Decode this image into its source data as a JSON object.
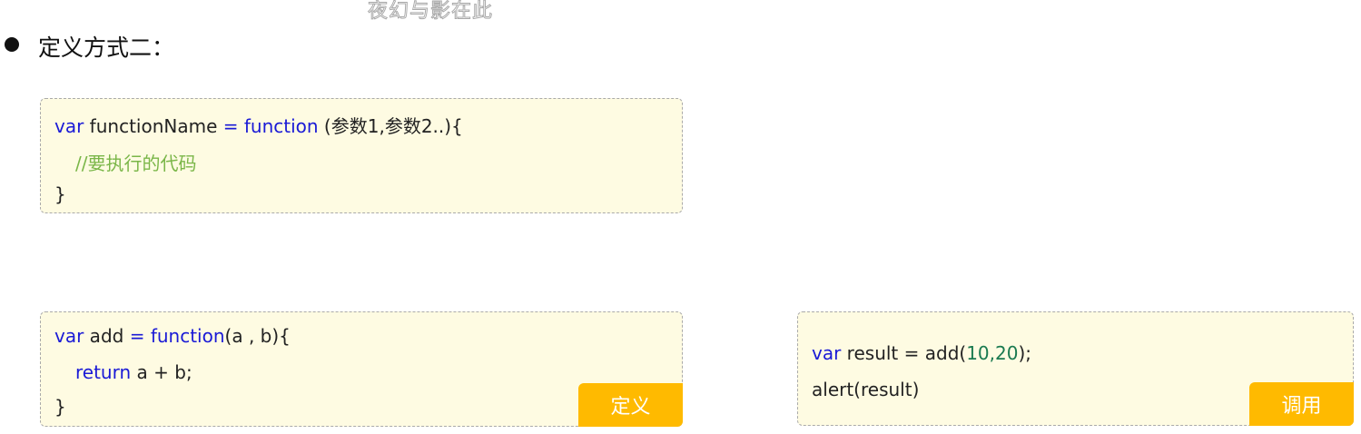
{
  "watermark": "夜幻与影在此",
  "heading": "定义方式二：",
  "box1": {
    "l1_var": "var",
    "l1_name": " functionName ",
    "l1_eq": "= function",
    "l1_rest": " (参数1,参数2..){",
    "l2": "//要执行的代码",
    "l3": "}"
  },
  "box2": {
    "l1_var": "var",
    "l1_name": " add ",
    "l1_eq": "= function",
    "l1_rest": "(a , b){",
    "l2_kw": "return",
    "l2_rest": " a + b;",
    "l3": "}",
    "tag": "定义"
  },
  "box3": {
    "l1_var": "var",
    "l1_a": " result = add(",
    "n1": "10",
    "comma": ",",
    "n2": "20",
    "l1_b": ");",
    "l2": "alert(result)",
    "tag": "调用"
  }
}
